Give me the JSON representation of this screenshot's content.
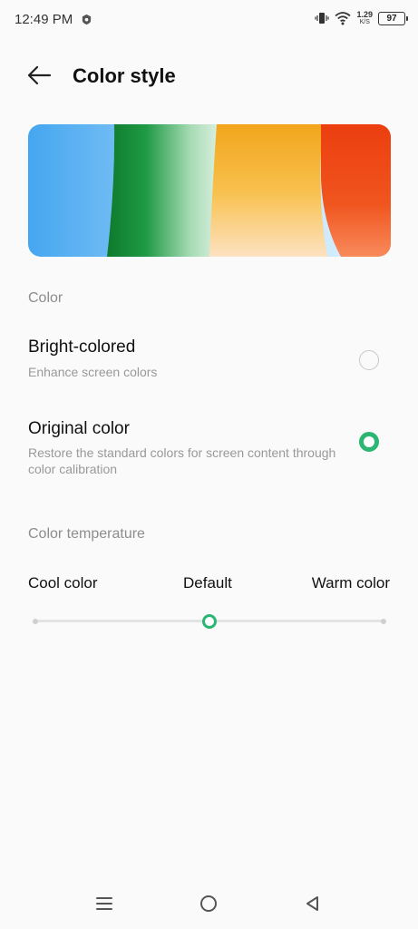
{
  "status_bar": {
    "time": "12:49 PM",
    "net_speed_value": "1.29",
    "net_speed_unit": "K/S",
    "battery_level": "97",
    "icons": [
      "shield-icon",
      "vibrate-icon",
      "wifi-icon",
      "battery-icon"
    ]
  },
  "header": {
    "title": "Color style",
    "back_icon": "arrow-left-icon"
  },
  "banner": {
    "colors": [
      "#4aaaf0",
      "#178c3a",
      "#f3a81e",
      "#ee4a15"
    ]
  },
  "color_section": {
    "label": "Color",
    "options": [
      {
        "title": "Bright-colored",
        "subtitle": "Enhance screen colors",
        "selected": false
      },
      {
        "title": "Original color",
        "subtitle": "Restore the standard colors for screen content through color calibration",
        "selected": true
      }
    ]
  },
  "temperature_section": {
    "label": "Color temperature",
    "cool_label": "Cool color",
    "default_label": "Default",
    "warm_label": "Warm color",
    "value": 0.5
  },
  "nav_bar": {
    "icons": [
      "menu-icon",
      "home-icon",
      "back-triangle-icon"
    ]
  },
  "accent_color": "#2bb673"
}
